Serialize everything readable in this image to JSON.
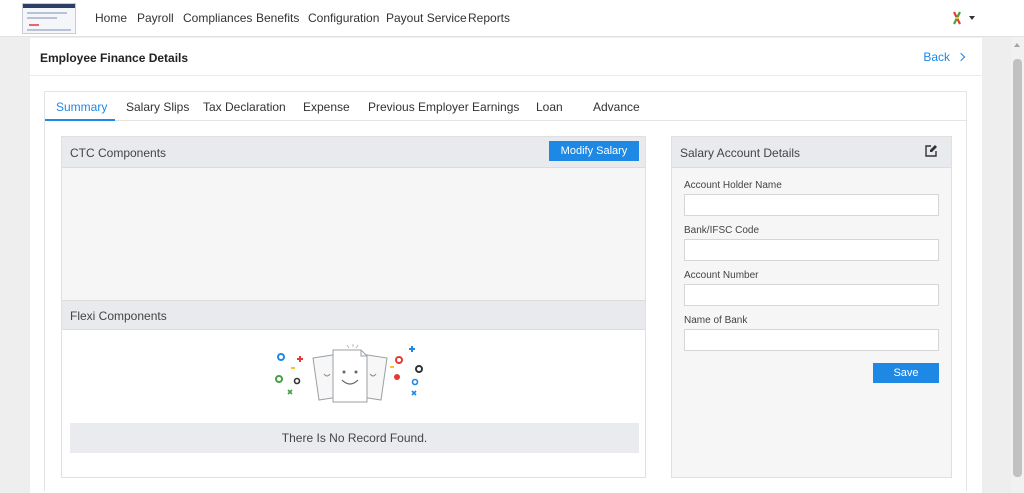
{
  "nav": {
    "items": [
      "Home",
      "Payroll",
      "Compliances",
      "Benefits",
      "Configuration",
      "Payout Service",
      "Reports"
    ]
  },
  "page": {
    "title": "Employee Finance Details",
    "back_label": "Back"
  },
  "tabs": [
    "Summary",
    "Salary Slips",
    "Tax Declaration",
    "Expense",
    "Previous Employer Earnings",
    "Loan",
    "Advance"
  ],
  "active_tab": "Summary",
  "ctc": {
    "title": "CTC Components",
    "modify_label": "Modify Salary"
  },
  "flexi": {
    "title": "Flexi Components",
    "empty_text": "There Is No Record Found."
  },
  "salary_account": {
    "title": "Salary Account Details",
    "fields": [
      {
        "label": "Account Holder Name",
        "value": ""
      },
      {
        "label": "Bank/IFSC Code",
        "value": ""
      },
      {
        "label": "Account Number",
        "value": ""
      },
      {
        "label": "Name of Bank",
        "value": ""
      }
    ],
    "save_label": "Save"
  },
  "colors": {
    "accent": "#1e88e5",
    "panel_header": "#e9eaed"
  }
}
